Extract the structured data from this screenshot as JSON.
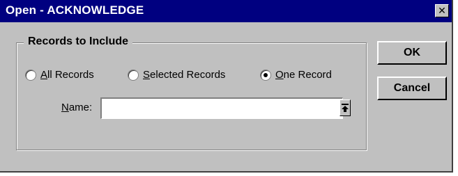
{
  "window": {
    "title": "Open - ACKNOWLEDGE",
    "close_glyph": "✕",
    "close_icon": "close-icon"
  },
  "group": {
    "label": "Records to Include",
    "options": [
      {
        "prefix": "",
        "accel": "A",
        "rest": "ll Records",
        "selected": false
      },
      {
        "prefix": "",
        "accel": "S",
        "rest": "elected Records",
        "selected": false
      },
      {
        "prefix": "",
        "accel": "O",
        "rest": "ne Record",
        "selected": true
      }
    ],
    "name_field": {
      "accel": "N",
      "rest": "ame:",
      "value": "",
      "dropdown_icon": "bar-up-arrow-icon"
    }
  },
  "buttons": {
    "ok": "OK",
    "cancel": "Cancel"
  },
  "colors": {
    "titlebar": "#000080",
    "face": "#c0c0c0"
  }
}
